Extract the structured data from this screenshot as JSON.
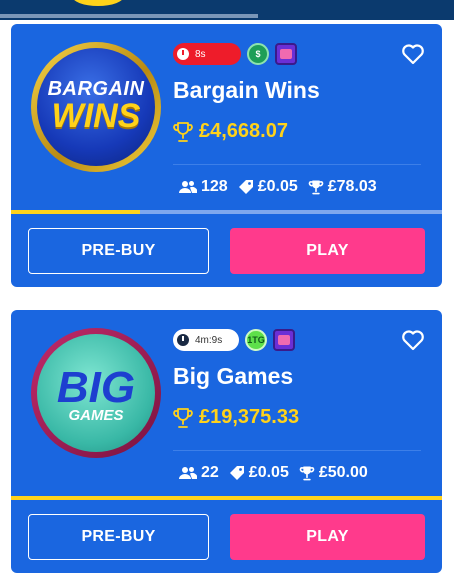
{
  "colors": {
    "card_bg": "#1a66e0",
    "accent_yellow": "#ffd21a",
    "play_pink": "#ff3a8c",
    "timer_red": "#ee1c2a"
  },
  "cards": [
    {
      "name": "Bargain Wins",
      "logo": {
        "line1": "BARGAIN",
        "line2": "WINS"
      },
      "timer": "8s",
      "timer_style": "red",
      "feature_badges": [
        "dollar-badge-icon",
        "ticket-badge-icon"
      ],
      "jackpot": "£4,668.07",
      "players": "128",
      "ticket_price": "£0.05",
      "prize": "£78.03",
      "progress": 0.3,
      "prebuy_label": "PRE-BUY",
      "play_label": "PLAY"
    },
    {
      "name": "Big Games",
      "logo": {
        "line1": "BIG",
        "line2": "GAMES"
      },
      "timer": "4m:9s",
      "timer_style": "white",
      "feature_badges": [
        "1tg-badge-icon",
        "ticket-badge-icon"
      ],
      "badge_text": "1TG",
      "jackpot": "£19,375.33",
      "players": "22",
      "ticket_price": "£0.05",
      "prize": "£50.00",
      "progress": 1.0,
      "prebuy_label": "PRE-BUY",
      "play_label": "PLAY"
    }
  ]
}
